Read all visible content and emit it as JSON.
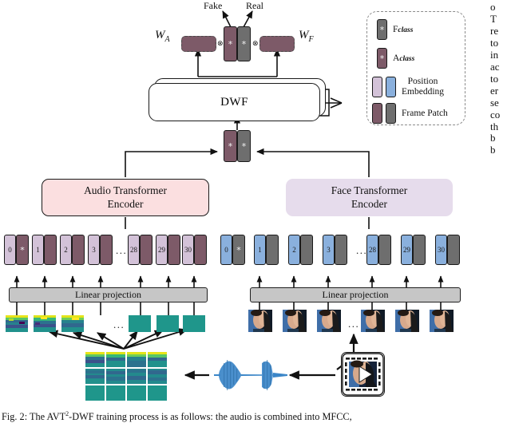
{
  "figure": {
    "caption": "Fig. 2: The AVT2-DWF training process is as follows: the audio is combined into MFCC,",
    "caption_sup": "2"
  },
  "outputs": {
    "fake_label": "Fake",
    "real_label": "Real"
  },
  "weights": {
    "audio_symbol": "W",
    "audio_sub": "A",
    "face_symbol": "W",
    "face_sub": "F",
    "otimes": "⊗"
  },
  "fusion": {
    "dwf_label": "DWF"
  },
  "encoders": {
    "audio_line1": "Audio Transformer",
    "audio_line2": "Encoder",
    "face_line1": "Face Transformer",
    "face_line2": "Encoder"
  },
  "projection": {
    "audio_label": "Linear projection",
    "face_label": "Linear projection"
  },
  "tokens": {
    "class_star": "*",
    "ellipsis": "...",
    "audio_sequence": [
      "0",
      "1",
      "2",
      "3",
      "28",
      "29",
      "30"
    ],
    "face_sequence": [
      "0",
      "1",
      "2",
      "3",
      "28",
      "29",
      "30"
    ]
  },
  "legend": {
    "items": [
      {
        "name": "F",
        "sub": "class",
        "type": "class-token-face",
        "star": "*"
      },
      {
        "name": "A",
        "sub": "class",
        "type": "class-token-audio",
        "star": "*"
      },
      {
        "line1": "Position",
        "line2": "Embedding",
        "type": "position-embedding"
      },
      {
        "line1": "Frame Patch",
        "line2": "",
        "type": "frame-patch"
      }
    ]
  },
  "colors": {
    "audio_patch": "#7d5a68",
    "face_patch": "#6e6e6e",
    "audio_position": "#d3c2d8",
    "face_position": "#8ab0dd",
    "audio_encoder_bg": "#fbdfe0",
    "face_encoder_bg": "#e6dcec",
    "linear_projection_bg": "#c6c6c6",
    "waveform": "#3b86c8",
    "spectrogram_base": "#1f968b"
  },
  "media": {
    "video_icon": "film-play-icon",
    "waveform_icon": "audio-waveform",
    "mfcc_grid_rows": 3,
    "mfcc_grid_cols": 4,
    "mfcc_strip_count": 6,
    "face_frame_count": 6
  },
  "side_text": {
    "lines": [
      "o",
      "T",
      "re",
      "to",
      "in",
      "ac",
      "to",
      "er",
      "se",
      "co",
      "th",
      "b",
      "b"
    ]
  }
}
